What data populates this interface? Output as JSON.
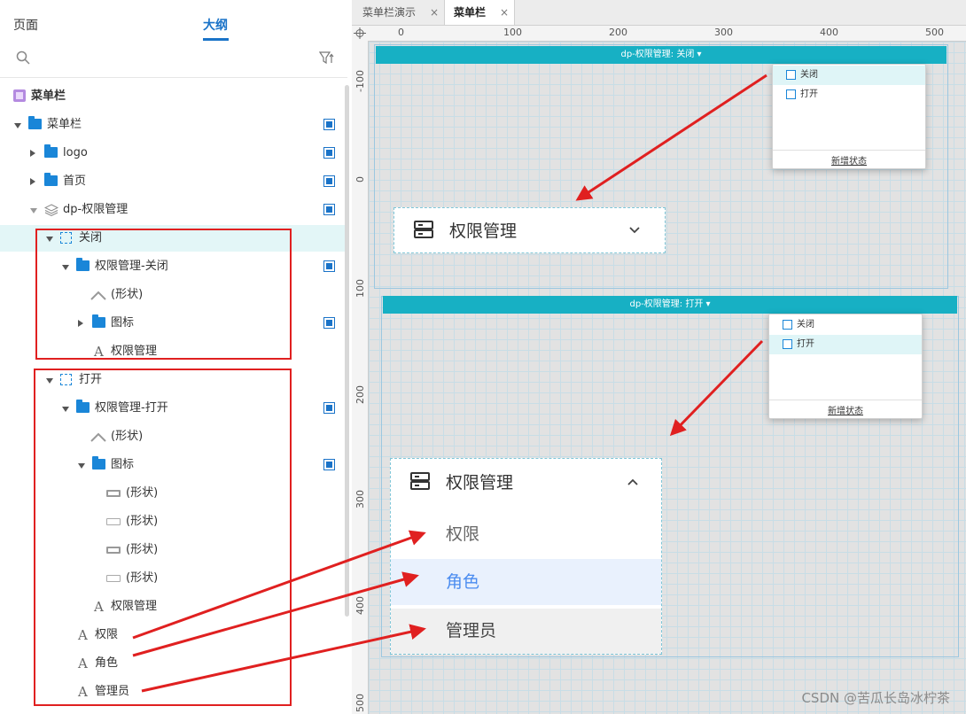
{
  "panel": {
    "tabs": [
      "页面",
      "大纲"
    ],
    "active_tab": "大纲"
  },
  "outline": {
    "page_title": "菜单栏",
    "rows": [
      {
        "label": "菜单栏"
      },
      {
        "label": "logo"
      },
      {
        "label": "首页"
      },
      {
        "label": "dp-权限管理"
      },
      {
        "label": "关闭"
      },
      {
        "label": "权限管理-关闭"
      },
      {
        "label": "(形状)"
      },
      {
        "label": "图标"
      },
      {
        "label": "权限管理"
      },
      {
        "label": "打开"
      },
      {
        "label": "权限管理-打开"
      },
      {
        "label": "(形状)"
      },
      {
        "label": "图标"
      },
      {
        "label": "(形状)"
      },
      {
        "label": "(形状)"
      },
      {
        "label": "(形状)"
      },
      {
        "label": "(形状)"
      },
      {
        "label": "权限管理"
      },
      {
        "label": "权限"
      },
      {
        "label": "角色"
      },
      {
        "label": "管理员"
      }
    ]
  },
  "editor": {
    "tabs": [
      {
        "label": "菜单栏演示",
        "close": "×"
      },
      {
        "label": "菜单栏",
        "close": "×"
      }
    ],
    "active_tab": "菜单栏"
  },
  "rulers": {
    "top": [
      "0",
      "100",
      "200",
      "300",
      "400",
      "500"
    ],
    "left": [
      "-100",
      "0",
      "100",
      "200",
      "300",
      "400",
      "500"
    ]
  },
  "closed_view": {
    "state_bar": "dp-权限管理: 关闭 ▾",
    "dropdown": {
      "items": [
        "关闭",
        "打开"
      ],
      "selected": "关闭",
      "add_state": "新增状态"
    },
    "menu": {
      "title": "权限管理"
    }
  },
  "open_view": {
    "state_bar": "dp-权限管理: 打开 ▾",
    "dropdown": {
      "items": [
        "关闭",
        "打开"
      ],
      "selected": "打开",
      "add_state": "新增状态"
    },
    "menu": {
      "title": "权限管理",
      "items": [
        "权限",
        "角色",
        "管理员"
      ]
    }
  },
  "colors": {
    "accent": "#17b0c4",
    "blue": "#1a86d8",
    "annotation": "#e02020",
    "role_text": "#4a8cf0"
  },
  "watermark": "CSDN @苦瓜长岛冰柠茶"
}
